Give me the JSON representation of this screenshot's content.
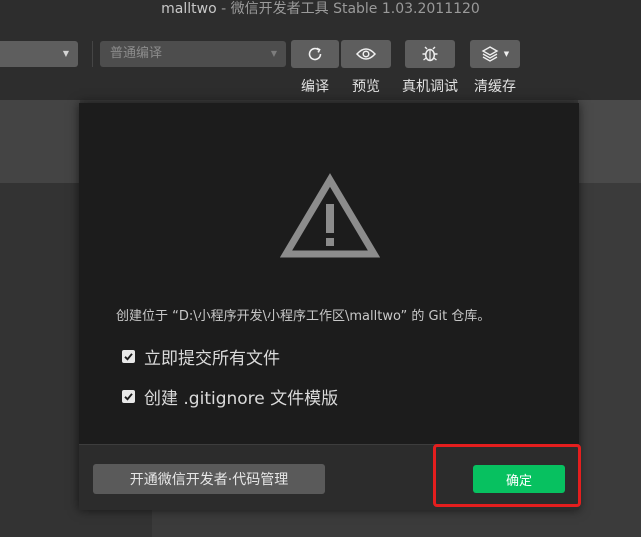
{
  "window": {
    "project_name": "malltwo",
    "title_separator": " - ",
    "app_title": "微信开发者工具 Stable 1.03.2011120"
  },
  "toolbar": {
    "compile_mode": {
      "value": "普通编译"
    },
    "buttons": [
      {
        "id": "compile",
        "icon": "refresh-icon",
        "label": "编译"
      },
      {
        "id": "preview",
        "icon": "eye-icon",
        "label": "预览"
      },
      {
        "id": "remote_debug",
        "icon": "bug-icon",
        "label": "真机调试"
      },
      {
        "id": "clear_cache",
        "icon": "layers-icon",
        "label": "清缓存"
      }
    ]
  },
  "dialog": {
    "icon": "warning-triangle-icon",
    "description": "创建位于 “D:\\小程序开发\\小程序工作区\\malltwo” 的 Git 仓库。",
    "options": [
      {
        "label": "立即提交所有文件",
        "checked": true
      },
      {
        "label": "创建 .gitignore 文件模版",
        "checked": true
      }
    ],
    "footer": {
      "open_button": "开通微信开发者·代码管理",
      "confirm_button": "确定"
    }
  },
  "colors": {
    "confirm_green": "#07c160",
    "highlight_red": "#e41e1e",
    "dialog_bg": "#1c1c1c"
  }
}
